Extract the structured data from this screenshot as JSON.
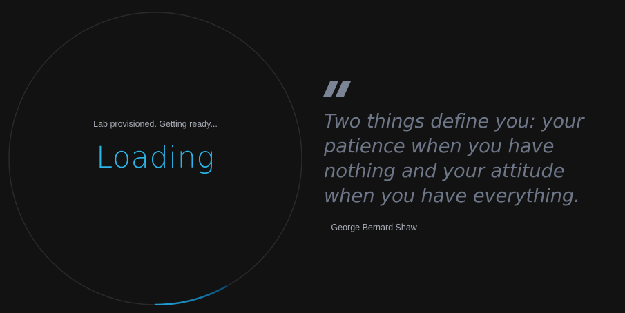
{
  "loader": {
    "status_text": "Lab provisioned. Getting ready...",
    "title": "Loading",
    "progress_fraction": 0.08,
    "track_color": "#2a2a2c",
    "arc_color": "#1fa3dc",
    "title_color": "#2bb5e8"
  },
  "quote": {
    "icon": "quote-mark-icon",
    "text": "Two things define you: your patience when you have nothing and your attitude when you have everything.",
    "author": "– George Bernard Shaw",
    "text_color": "#6e7788"
  }
}
